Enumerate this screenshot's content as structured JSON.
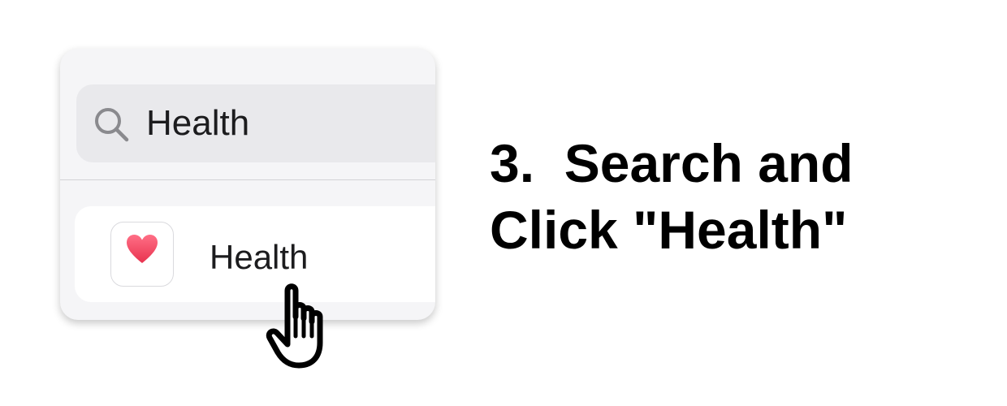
{
  "search": {
    "value": "Health",
    "icon": "search-icon"
  },
  "result": {
    "label": "Health",
    "icon": "heart-icon",
    "icon_color": "#f0566e"
  },
  "cursor": {
    "icon": "hand-pointer-icon"
  },
  "instruction": {
    "line1": "3.  Search and",
    "line2": "Click \"Health\""
  }
}
